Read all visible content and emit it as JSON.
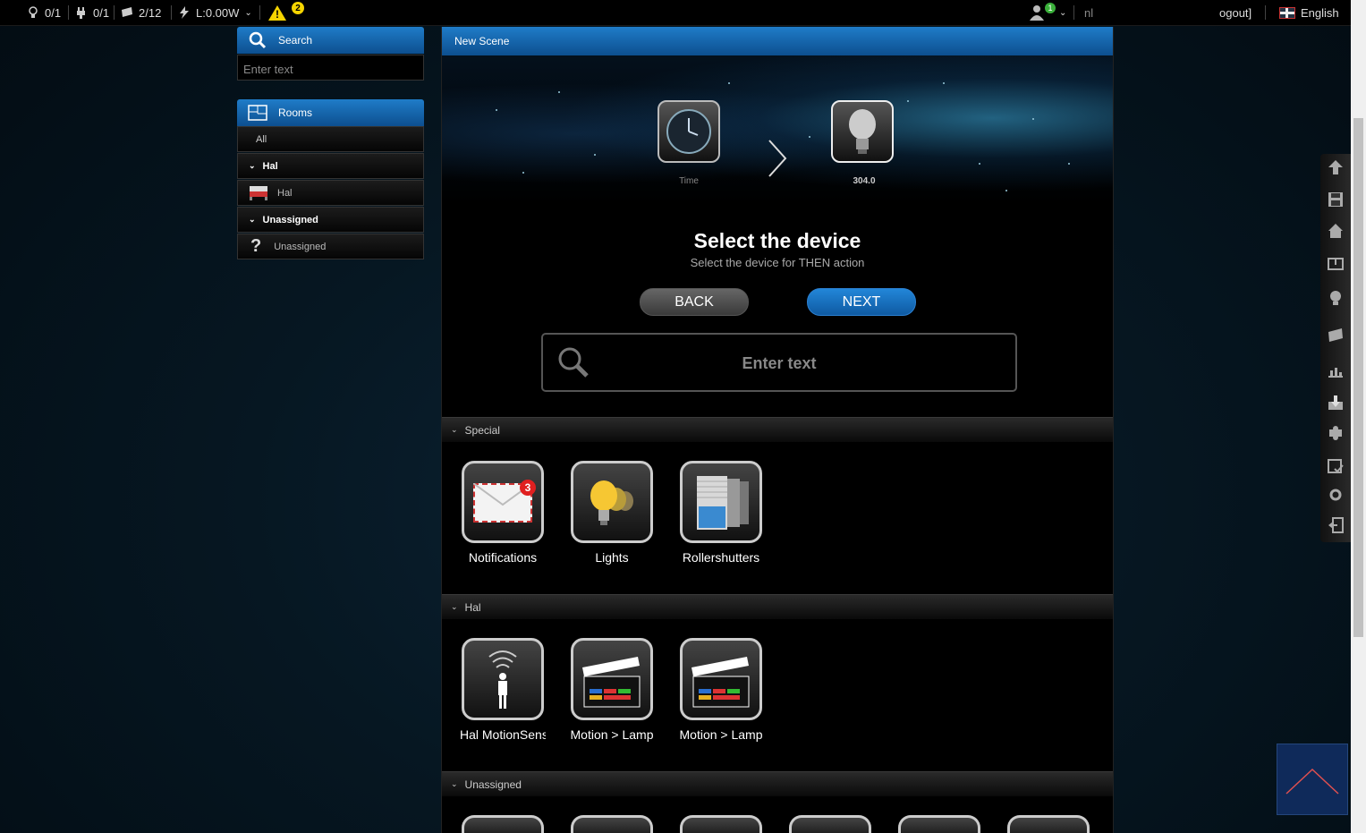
{
  "topbar": {
    "lights": "0/1",
    "plugs": "0/1",
    "shutters": "2/12",
    "power": "L:0.00W",
    "warnings": "2",
    "users": "1",
    "user_text": "nl",
    "logout_text": "ogout]",
    "language": "English"
  },
  "sidebar": {
    "search_title": "Search",
    "search_placeholder": "Enter text",
    "rooms_title": "Rooms",
    "rooms": [
      {
        "label": "All"
      },
      {
        "label": "Hal"
      },
      {
        "label": "Hal"
      },
      {
        "label": "Unassigned"
      },
      {
        "label": "Unassigned"
      }
    ]
  },
  "main": {
    "title": "New Scene",
    "step1_label": "Time",
    "step2_label": "304.0",
    "heading": "Select the device",
    "subheading": "Select the device for THEN action",
    "back_label": "BACK",
    "next_label": "NEXT",
    "search_placeholder": "Enter text",
    "sections": [
      {
        "title": "Special",
        "tiles": [
          "Notifications",
          "Lights",
          "Rollershutters"
        ]
      },
      {
        "title": "Hal",
        "tiles": [
          "Hal MotionSens",
          "Motion > Lamp",
          "Motion > Lamp"
        ]
      },
      {
        "title": "Unassigned",
        "tiles": []
      }
    ],
    "notification_count": "3"
  },
  "colors": {
    "accent": "#1f7cc8",
    "warning": "#f5d400",
    "badge_red": "#e02020"
  }
}
